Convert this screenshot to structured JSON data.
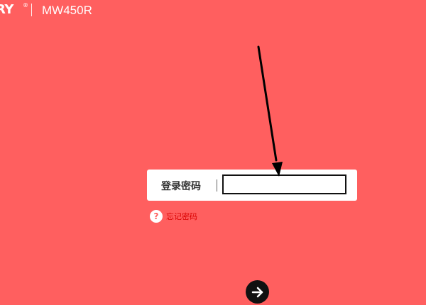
{
  "header": {
    "brand": "RY",
    "brand_mark": "®",
    "model": "MW450R"
  },
  "login": {
    "label": "登录密码",
    "password_value": "",
    "password_placeholder": ""
  },
  "forgot": {
    "icon": "question-mark-icon",
    "icon_glyph": "?",
    "label": "忘记密码"
  },
  "submit": {
    "icon": "arrow-right-icon"
  },
  "colors": {
    "background": "#ff5f5f",
    "box": "#ffffff",
    "link": "#d90000",
    "button": "#111111"
  }
}
